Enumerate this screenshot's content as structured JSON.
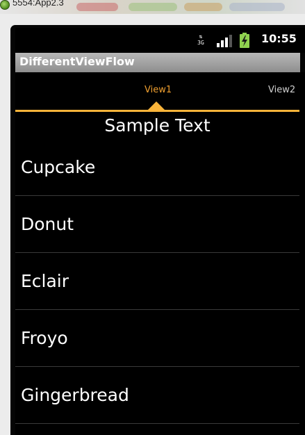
{
  "window": {
    "title": "5554:App2.3"
  },
  "status_bar": {
    "network_icon": "3g-data-icon",
    "network_label": "3G",
    "signal_icon": "signal-bars-icon",
    "battery_icon": "battery-charging-icon",
    "time": "10:55"
  },
  "app": {
    "title": "DifferentViewFlow"
  },
  "tabs": [
    {
      "label": "View1",
      "active": true
    },
    {
      "label": "View2",
      "active": false
    }
  ],
  "content": {
    "header_text": "Sample Text",
    "list_items": [
      "Cupcake",
      "Donut",
      "Eclair",
      "Froyo",
      "Gingerbread"
    ]
  },
  "colors": {
    "tab_accent": "#f9b43a",
    "active_tab_text": "#f0a030",
    "background": "#000000"
  }
}
